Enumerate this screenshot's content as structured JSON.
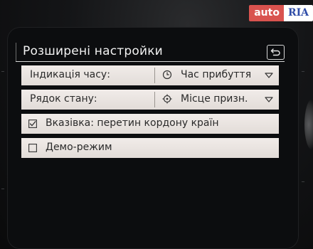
{
  "watermark": {
    "auto": "auto",
    "ria": "RIA"
  },
  "page": {
    "title": "Розширені настройки",
    "back_icon": "back-arrow-icon"
  },
  "settings": {
    "time_display": {
      "label": "Індикація часу:",
      "value": "Час прибуття",
      "icon": "clock-icon"
    },
    "status_bar": {
      "label": "Рядок стану:",
      "value": "Місце призн.",
      "icon": "destination-crosshair-icon"
    },
    "border_warning": {
      "label": "Вказівка: перетин кордону країн",
      "checked": true
    },
    "demo_mode": {
      "label": "Демо-режим",
      "checked": false
    }
  },
  "colors": {
    "row_background": "#ebe6e2",
    "screen_background": "#0c0d0f",
    "title_text": "#f2f2f2",
    "watermark_red": "#d9534f",
    "watermark_blue": "#2f4da8"
  }
}
